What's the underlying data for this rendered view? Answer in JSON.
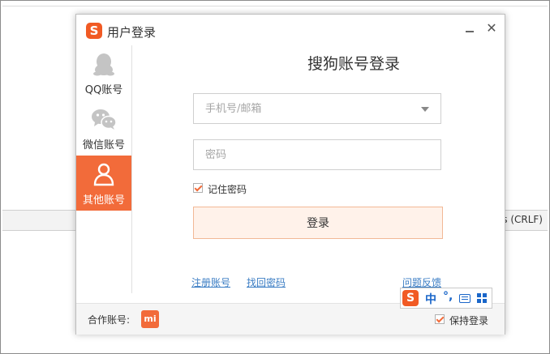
{
  "background": {
    "status_text": "ws (CRLF)"
  },
  "dialog": {
    "logo_letter": "S",
    "title": "用户登录",
    "close_glyph": "✕",
    "heading": "搜狗账号登录",
    "tabs": [
      {
        "label": "QQ账号",
        "icon": "qq-penguin-icon",
        "active": false
      },
      {
        "label": "微信账号",
        "icon": "wechat-icon",
        "active": false
      },
      {
        "label": "其他账号",
        "icon": "user-icon",
        "active": true
      }
    ],
    "account_field": {
      "placeholder": "手机号/邮箱",
      "value": ""
    },
    "password_field": {
      "placeholder": "密码",
      "value": ""
    },
    "remember_password": {
      "label": "记住密码",
      "checked": true
    },
    "login_button": "登录",
    "links": {
      "register": "注册账号",
      "find_password": "找回密码",
      "feedback": "问题反馈"
    },
    "footer": {
      "partner_label": "合作账号:",
      "partner_logo_text": "mi",
      "keep_login": {
        "label": "保持登录",
        "checked": true
      }
    }
  },
  "ime_toolbar": {
    "logo_letter": "S",
    "mode": "中",
    "punct": "°,"
  },
  "colors": {
    "accent": "#f26b3a",
    "link": "#3b7dc4",
    "ime_blue": "#1a66c9"
  }
}
